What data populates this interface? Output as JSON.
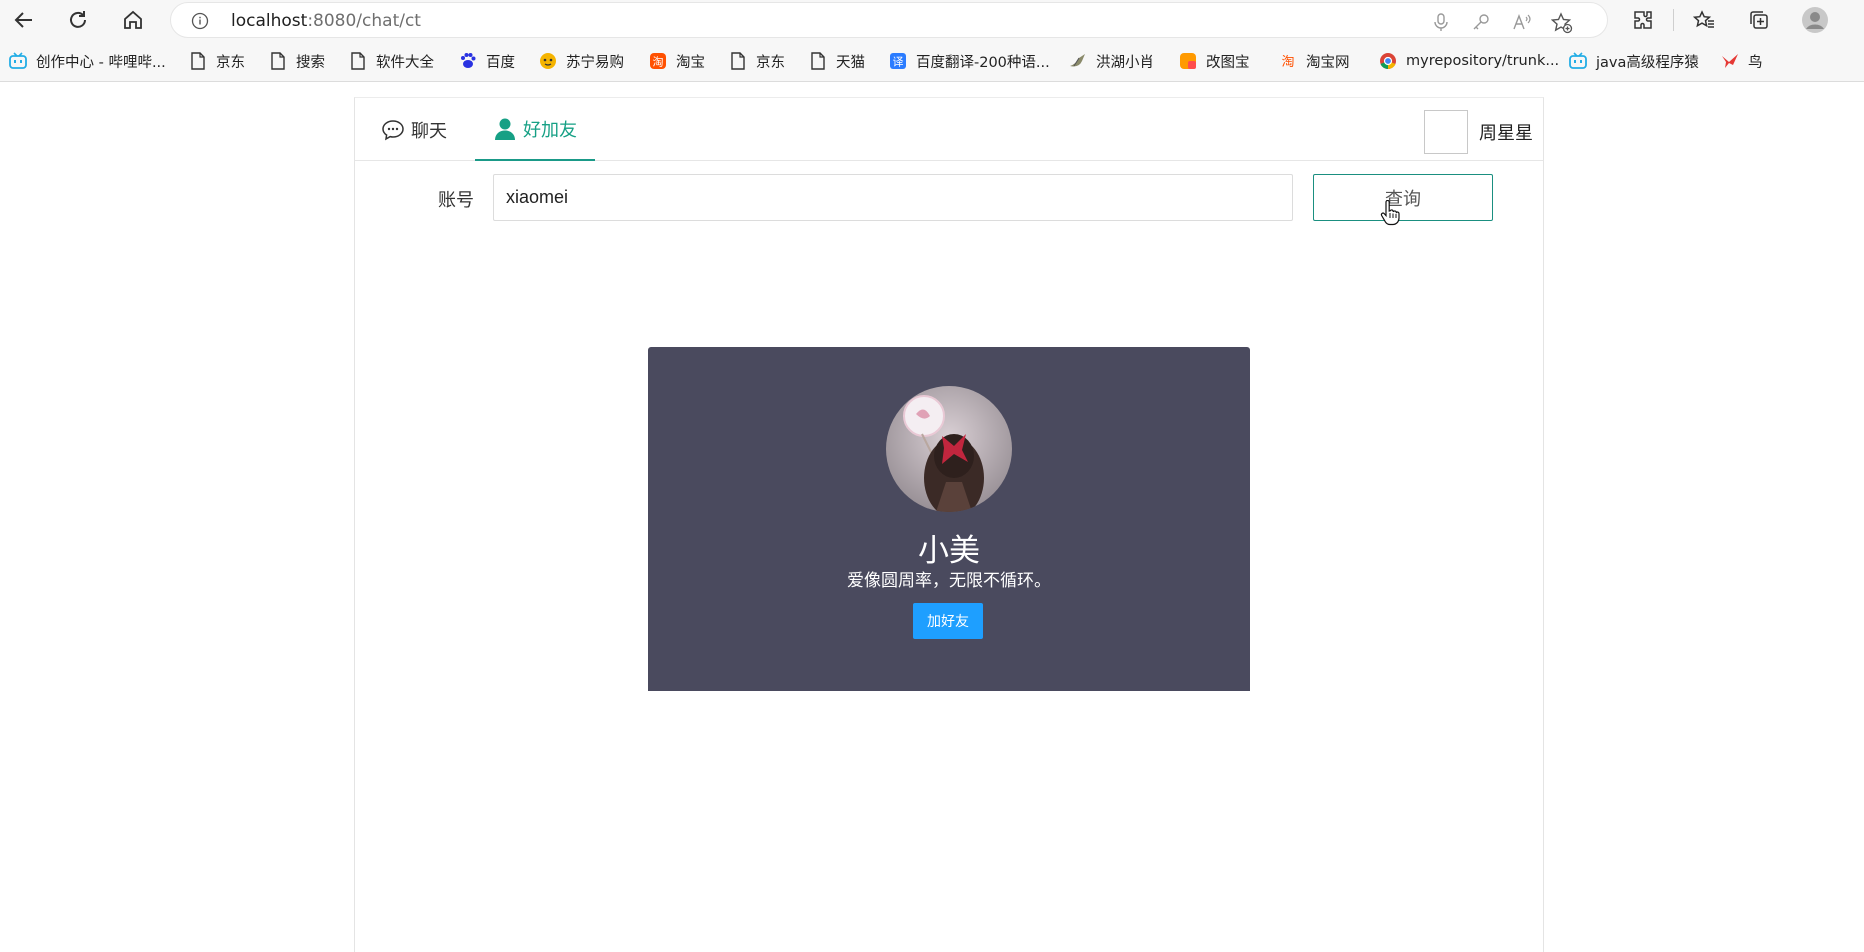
{
  "browser": {
    "url_host": "localhost",
    "url_rest": ":8080/chat/ct",
    "bookmarks": [
      {
        "label": "创作中心 - 哔哩哔...",
        "icon": "bilibili-icon"
      },
      {
        "label": "京东",
        "icon": "page-icon"
      },
      {
        "label": "搜索",
        "icon": "page-icon"
      },
      {
        "label": "软件大全",
        "icon": "page-icon"
      },
      {
        "label": "百度",
        "icon": "baidu-icon"
      },
      {
        "label": "苏宁易购",
        "icon": "suning-icon"
      },
      {
        "label": "淘宝",
        "icon": "taobao-icon"
      },
      {
        "label": "京东",
        "icon": "page-icon"
      },
      {
        "label": "天猫",
        "icon": "page-icon"
      },
      {
        "label": "百度翻译-200种语...",
        "icon": "translate-icon"
      },
      {
        "label": "洪湖小肖",
        "icon": "bird-icon"
      },
      {
        "label": "改图宝",
        "icon": "gaitubao-icon"
      },
      {
        "label": "淘宝网",
        "icon": "taobao-icon"
      },
      {
        "label": "myrepository/trunk...",
        "icon": "chrome-icon"
      },
      {
        "label": "java高级程序猿",
        "icon": "bilibili-icon"
      },
      {
        "label": "鸟",
        "icon": "bird-red-icon"
      }
    ]
  },
  "app": {
    "tabs": [
      {
        "label": "聊天",
        "icon": "chat-bubble-icon"
      },
      {
        "label": "好加友",
        "icon": "user-icon"
      }
    ],
    "current_user": {
      "name": "周星星"
    },
    "search": {
      "label": "账号",
      "value": "xiaomei",
      "button": "查询"
    },
    "result": {
      "name": "小美",
      "bio": "爱像圆周率，无限不循环。",
      "add_button": "加好友"
    }
  },
  "colors": {
    "accent": "#16a085",
    "card_bg": "#4a4a5e",
    "add_button": "#1e9fff"
  }
}
